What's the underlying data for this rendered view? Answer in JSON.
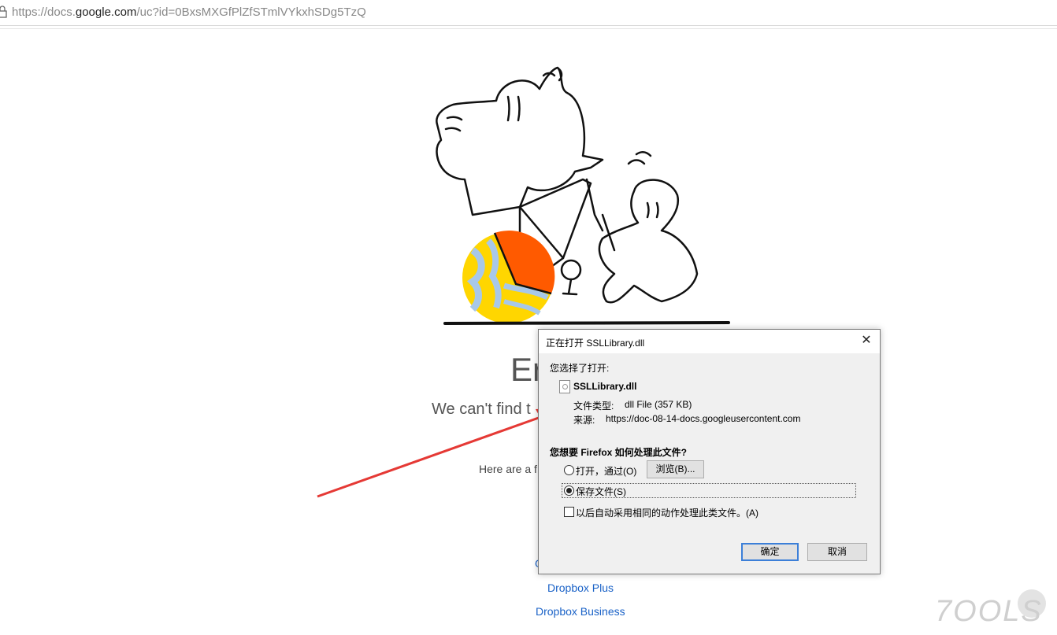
{
  "browser": {
    "url_prefix": "https://docs.",
    "url_domain": "google.com",
    "url_suffix": "/uc?id=0BxsMXGfPlZfSTmlVYkxhSDg5TzQ"
  },
  "page": {
    "error_title": "Er",
    "error_subtitle": "We can't find t",
    "hint_text": "Here are a f",
    "partial_link": "G",
    "links": [
      "Dropbox Plus",
      "Dropbox Business"
    ]
  },
  "dialog": {
    "title": "正在打开 SSLLibrary.dll",
    "close_glyph": "✕",
    "chosen_label": "您选择了打开:",
    "file_name": "SSLLibrary.dll",
    "file_type_label": "文件类型:",
    "file_type_value": "dll File (357 KB)",
    "source_label": "来源:",
    "source_value": "https://doc-08-14-docs.googleusercontent.com",
    "question": "您想要 Firefox 如何处理此文件?",
    "open_with_label": "打开，通过(O)",
    "browse_button": "浏览(B)...",
    "save_file_label": "保存文件(S)",
    "remember_label": "以后自动采用相同的动作处理此类文件。(A)",
    "ok_button": "确定",
    "cancel_button": "取消",
    "open_with_selected": false,
    "save_file_selected": true,
    "remember_checked": false
  },
  "watermark": {
    "text": "7OOLS"
  },
  "colors": {
    "link": "#1a62c7",
    "arrow": "#e53935",
    "ball_orange": "#ff5a00",
    "ball_yellow": "#ffd600",
    "ball_blue": "#a8c8e8",
    "primary_button_border": "#3c7fd8"
  },
  "icons": [
    "lock-icon",
    "file-icon",
    "close-icon",
    "red-arrow"
  ]
}
